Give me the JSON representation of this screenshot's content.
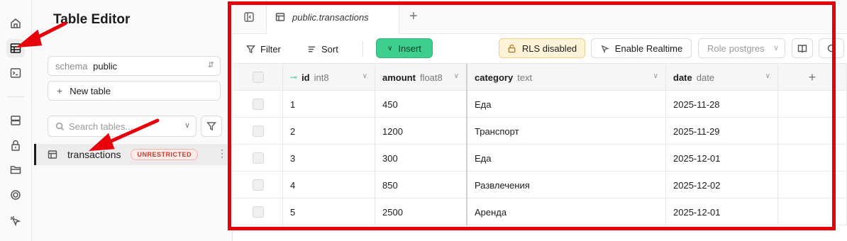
{
  "sidebar": {
    "title": "Table Editor",
    "schema_label": "schema",
    "schema_value": "public",
    "new_table_label": "New table",
    "search_placeholder": "Search tables...",
    "table_item": {
      "name": "transactions",
      "badge": "UNRESTRICTED"
    }
  },
  "tab": {
    "label": "public.transactions"
  },
  "toolbar": {
    "filter_label": "Filter",
    "sort_label": "Sort",
    "insert_label": "Insert",
    "rls_label": "RLS disabled",
    "realtime_label": "Enable Realtime",
    "role_label": "Role",
    "role_value": "postgres"
  },
  "columns": [
    {
      "name": "id",
      "type": "int8"
    },
    {
      "name": "amount",
      "type": "float8"
    },
    {
      "name": "category",
      "type": "text"
    },
    {
      "name": "date",
      "type": "date"
    }
  ],
  "rows": [
    {
      "id": "1",
      "amount": "450",
      "category": "Еда",
      "date": "2025-11-28"
    },
    {
      "id": "2",
      "amount": "1200",
      "category": "Транспорт",
      "date": "2025-11-29"
    },
    {
      "id": "3",
      "amount": "300",
      "category": "Еда",
      "date": "2025-12-01"
    },
    {
      "id": "4",
      "amount": "850",
      "category": "Развлечения",
      "date": "2025-12-02"
    },
    {
      "id": "5",
      "amount": "2500",
      "category": "Аренда",
      "date": "2025-12-01"
    }
  ],
  "colors": {
    "brand_green": "#3ecf8e",
    "annotation_red": "#e8000b",
    "rls_warning_bg": "#fdf3d9"
  },
  "icons": {
    "rail": [
      "home-icon",
      "table-editor-icon",
      "sql-editor-icon",
      "database-icon",
      "auth-icon",
      "storage-icon",
      "realtime-icon",
      "advisors-icon"
    ]
  }
}
